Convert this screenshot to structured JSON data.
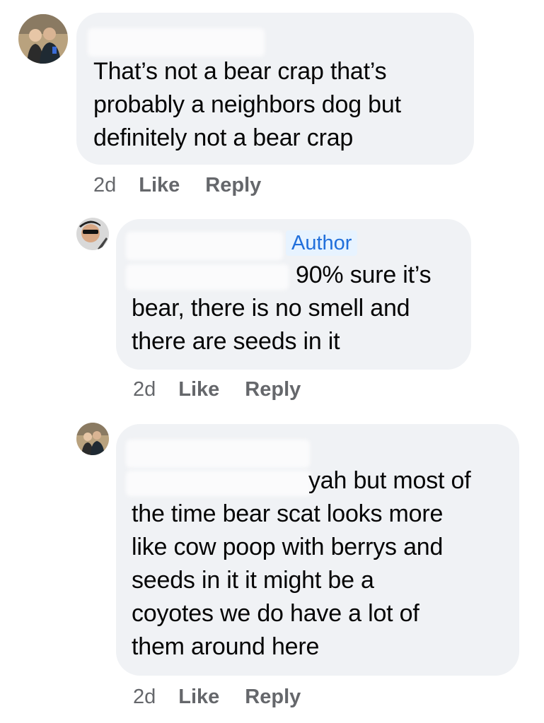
{
  "comments": [
    {
      "text": "That’s not a bear crap that’s\nprobably a neighbors dog but\ndefinitely not a bear crap",
      "time": "2d",
      "like_label": "Like",
      "reply_label": "Reply"
    },
    {
      "badge": "Author",
      "text_first": "90% sure it’s",
      "text": "bear, there is no smell and\nthere are seeds in it",
      "time": "2d",
      "like_label": "Like",
      "reply_label": "Reply"
    },
    {
      "text_first": "yah but most of",
      "text": "the time bear scat looks more\nlike cow poop with berrys and\nseeds in it it might be a\ncoyotes we do have a lot of\nthem around here",
      "time": "2d",
      "like_label": "Like",
      "reply_label": "Reply"
    }
  ],
  "colors": {
    "bubble": "#f0f2f5",
    "text": "#050505",
    "meta": "#65676b",
    "badge_bg": "#e7f3ff",
    "badge_text": "#216fdb"
  }
}
